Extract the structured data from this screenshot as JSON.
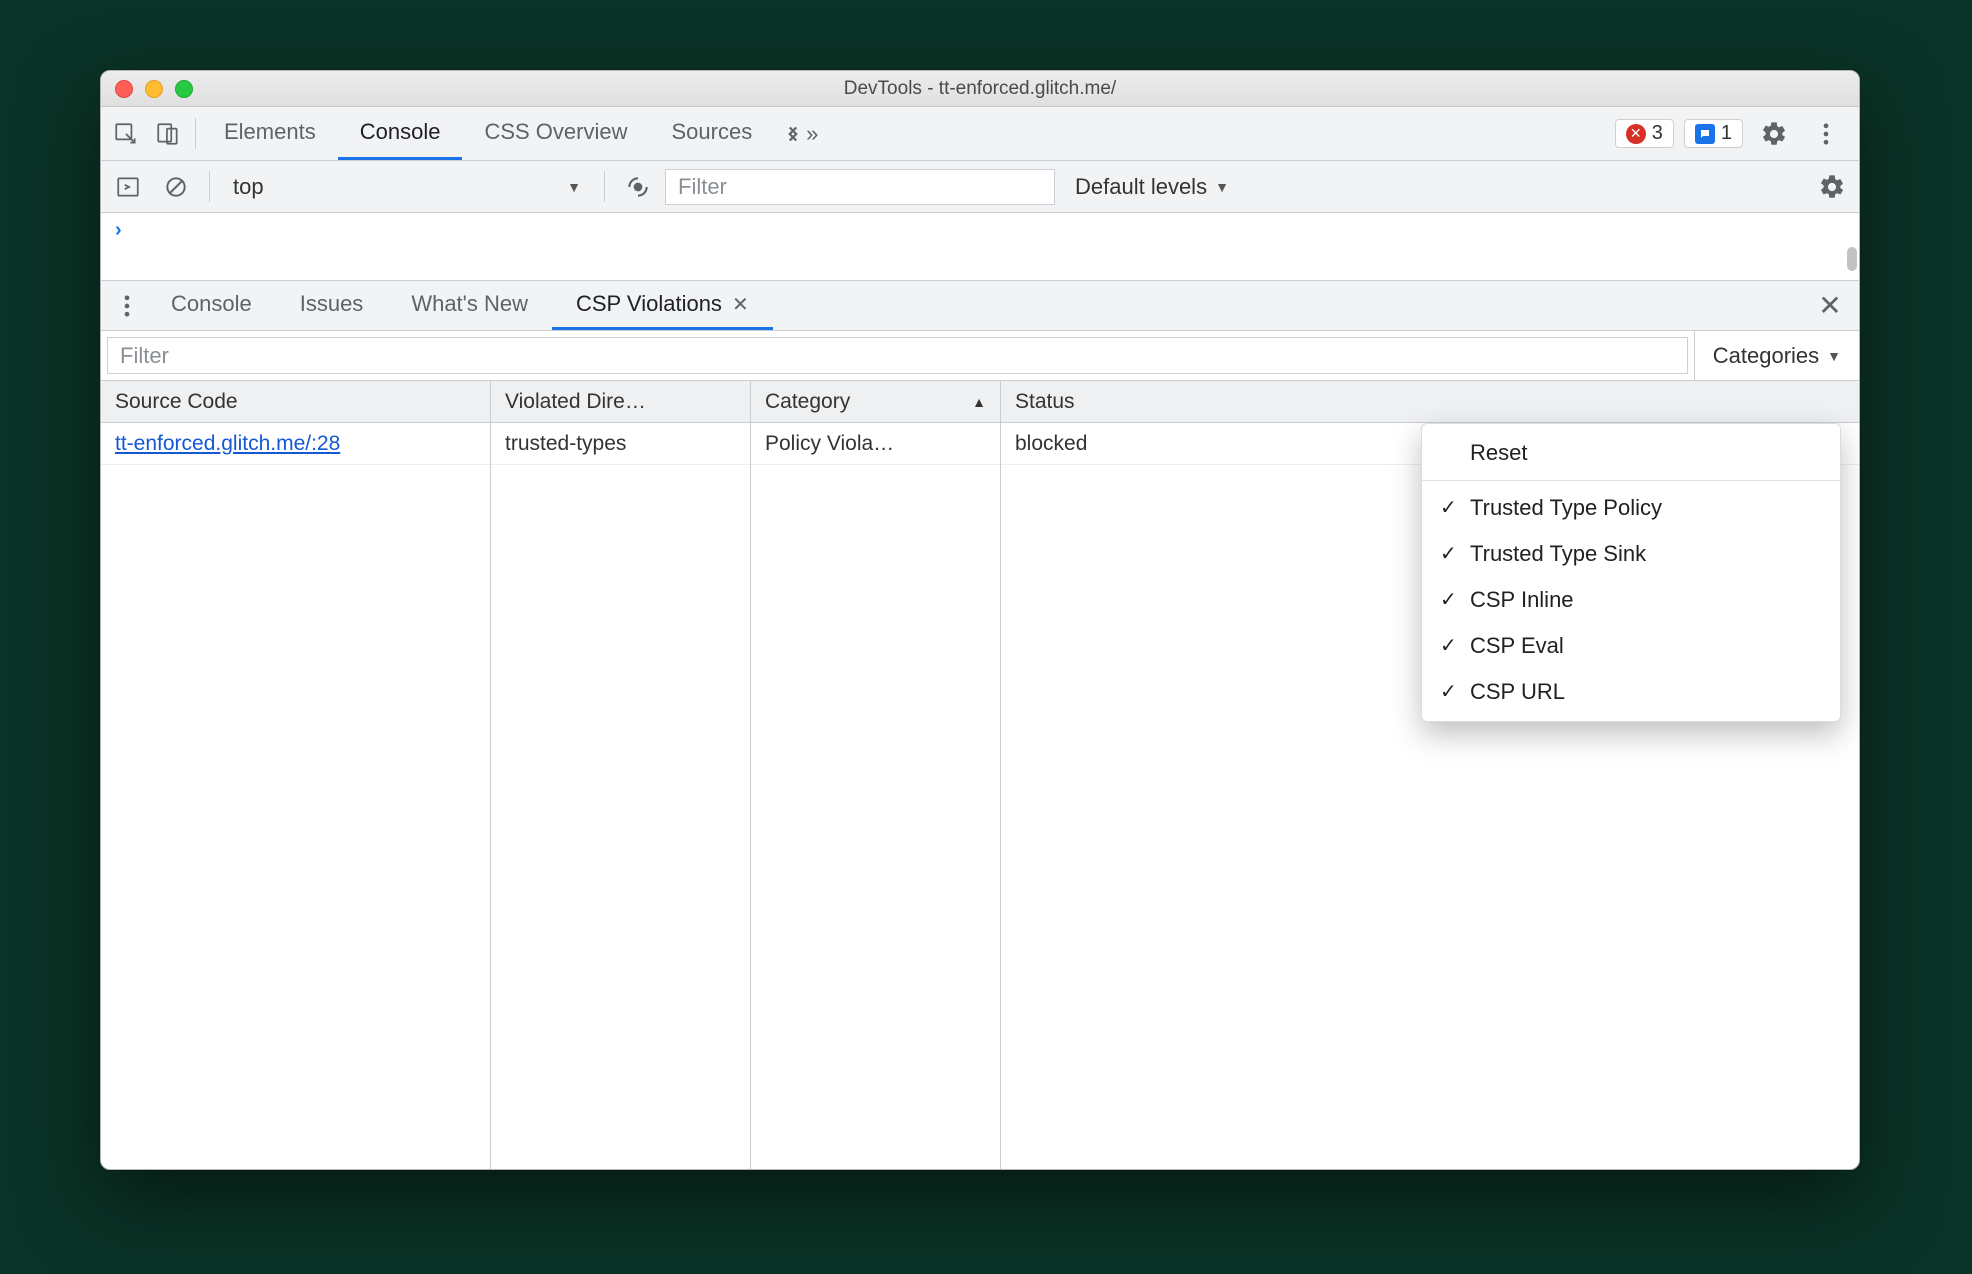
{
  "window": {
    "title": "DevTools - tt-enforced.glitch.me/"
  },
  "main_tabs": {
    "items": [
      "Elements",
      "Console",
      "CSS Overview",
      "Sources"
    ],
    "active_index": 1
  },
  "status": {
    "errors_count": "3",
    "issues_count": "1"
  },
  "console_bar": {
    "context": "top",
    "filter_placeholder": "Filter",
    "levels_label": "Default levels"
  },
  "drawer_tabs": {
    "items": [
      "Console",
      "Issues",
      "What's New",
      "CSP Violations"
    ],
    "active_index": 3,
    "closable_index": 3
  },
  "csp": {
    "filter_placeholder": "Filter",
    "categories_label": "Categories",
    "columns": [
      "Source Code",
      "Violated Dire…",
      "Category",
      "Status"
    ],
    "sort_col": 2,
    "rows": [
      {
        "source": "tt-enforced.glitch.me/:28",
        "directive": "trusted-types",
        "category": "Policy Viola…",
        "status": "blocked"
      }
    ]
  },
  "categories_menu": {
    "reset": "Reset",
    "items": [
      {
        "label": "Trusted Type Policy",
        "checked": true
      },
      {
        "label": "Trusted Type Sink",
        "checked": true
      },
      {
        "label": "CSP Inline",
        "checked": true
      },
      {
        "label": "CSP Eval",
        "checked": true
      },
      {
        "label": "CSP URL",
        "checked": true
      }
    ]
  }
}
